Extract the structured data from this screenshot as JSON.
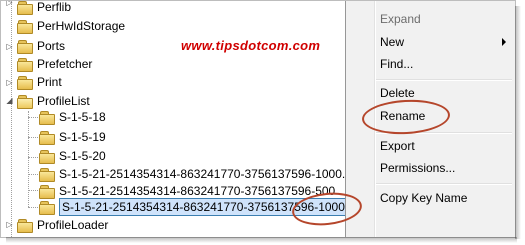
{
  "watermark": "www.tipsdotcom.com",
  "tree": {
    "items": [
      {
        "label": "Perflib"
      },
      {
        "label": "PerHwIdStorage"
      },
      {
        "label": "Ports"
      },
      {
        "label": "Prefetcher"
      },
      {
        "label": "Print"
      },
      {
        "label": "ProfileList"
      },
      {
        "label": "S-1-5-18"
      },
      {
        "label": "S-1-5-19"
      },
      {
        "label": "S-1-5-20"
      },
      {
        "label": "S-1-5-21-2514354314-863241770-3756137596-1000.ba"
      },
      {
        "label": "S-1-5-21-2514354314-863241770-3756137596-500"
      },
      {
        "label": "S-1-5-21-2514354314-863241770-3756137596-1000.bak"
      },
      {
        "label": "ProfileLoader"
      }
    ]
  },
  "context_menu": {
    "items": [
      {
        "label": "Expand"
      },
      {
        "label": "New"
      },
      {
        "label": "Find..."
      },
      {
        "label": "Delete"
      },
      {
        "label": "Rename"
      },
      {
        "label": "Export"
      },
      {
        "label": "Permissions..."
      },
      {
        "label": "Copy Key Name"
      }
    ]
  },
  "colors": {
    "watermark": "#d00000",
    "highlight_ellipse": "#b5462b",
    "menu_background": "#f1f1f1",
    "folder": "#e6bd4d",
    "edit_box": "#cfe3fb"
  }
}
